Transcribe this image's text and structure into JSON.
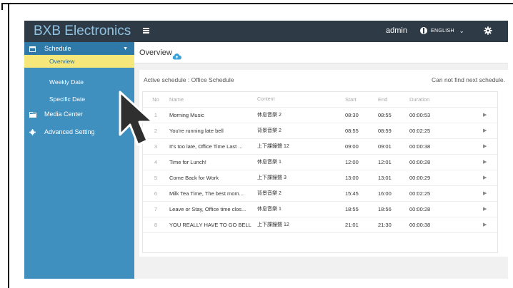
{
  "brand": "BXB Electronics",
  "sidebar": {
    "schedule_label": "Schedule",
    "sub_items": [
      {
        "label": "Overview",
        "active": true
      },
      {
        "label": "Weekly Date",
        "active": false
      },
      {
        "label": "Specific Date",
        "active": false
      }
    ],
    "media_label": "Media Center",
    "advanced_label": "Advanced Setting"
  },
  "topbar": {
    "user": "admin",
    "language": "ENGLISH"
  },
  "page": {
    "title": "Overview",
    "active_schedule": "Active schedule : Office Schedule",
    "next_schedule": "Can not find next schedule."
  },
  "table": {
    "headers": {
      "no": "No",
      "name": "Name",
      "content": "Content",
      "start": "Start",
      "end": "End",
      "duration": "Duration"
    },
    "rows": [
      {
        "no": "1",
        "name": "Morning Music",
        "content": "休息音樂 2",
        "start": "08:30",
        "end": "08:55",
        "duration": "00:00:53"
      },
      {
        "no": "2",
        "name": "You're running late bell",
        "content": "背景音樂 2",
        "start": "08:55",
        "end": "08:59",
        "duration": "00:02:25"
      },
      {
        "no": "3",
        "name": "It's too late, Office Time Last ...",
        "content": "上下課鐘聲 12",
        "start": "09:00",
        "end": "09:01",
        "duration": "00:00:38"
      },
      {
        "no": "4",
        "name": "Time for Lunch!",
        "content": "休息音樂 1",
        "start": "12:00",
        "end": "12:01",
        "duration": "00:00:28"
      },
      {
        "no": "5",
        "name": "Come Back for Work",
        "content": "上下課鐘聲 3",
        "start": "13:00",
        "end": "13:01",
        "duration": "00:00:29"
      },
      {
        "no": "6",
        "name": "Milk Tea Time, The best mom...",
        "content": "背景音樂 2",
        "start": "15:45",
        "end": "16:00",
        "duration": "00:02:25"
      },
      {
        "no": "7",
        "name": "Leave or Stay, Office time clos...",
        "content": "休息音樂 1",
        "start": "18:55",
        "end": "18:56",
        "duration": "00:00:28"
      },
      {
        "no": "8",
        "name": "YOU REALLY HAVE TO GO BELL",
        "content": "上下課鐘聲 12",
        "start": "21:01",
        "end": "21:30",
        "duration": "00:00:38"
      }
    ]
  },
  "colors": {
    "sidebar": "#3f8fbf",
    "topbar": "#2e3b47",
    "active_item": "#f6e77a",
    "accent": "#3aa2d8"
  }
}
